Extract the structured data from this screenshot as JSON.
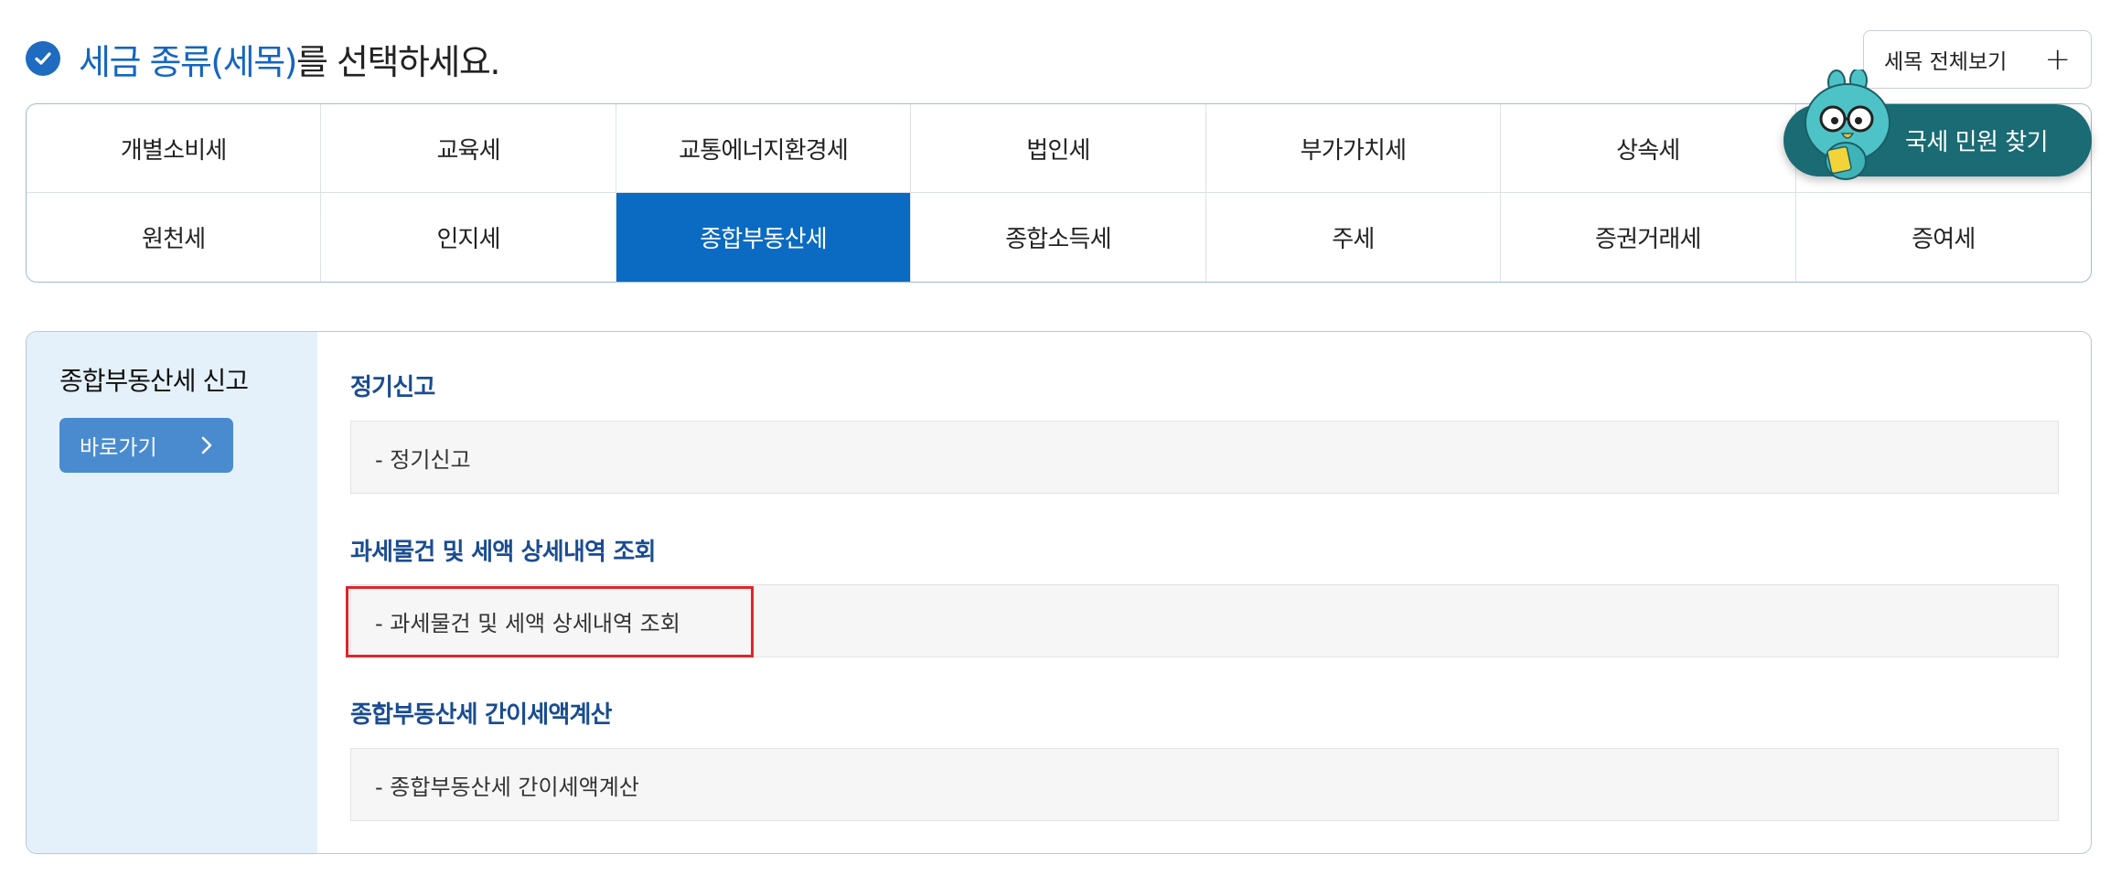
{
  "heading": {
    "highlight": "세금 종류(세목)",
    "rest": "를 선택하세요."
  },
  "view_all": {
    "label": "세목 전체보기",
    "icon": "+"
  },
  "tax_types": [
    "개별소비세",
    "교육세",
    "교통에너지환경세",
    "법인세",
    "부가가치세",
    "상속세",
    "",
    "원천세",
    "인지세",
    "종합부동산세",
    "종합소득세",
    "주세",
    "증권거래세",
    "증여세"
  ],
  "active_tax": "종합부동산세",
  "mascot": {
    "label": "국세 민원 찾기",
    "color": "#1a6b73"
  },
  "panel": {
    "side_title": "종합부동산세 신고",
    "shortcut_label": "바로가기",
    "sections": [
      {
        "title": "정기신고",
        "link": "- 정기신고"
      },
      {
        "title": "과세물건 및 세액 상세내역 조회",
        "link": "- 과세물건 및 세액 상세내역 조회"
      },
      {
        "title": "종합부동산세 간이세액계산",
        "link": "- 종합부동산세 간이세액계산"
      }
    ]
  },
  "colors": {
    "accent": "#0b6bc2",
    "section_title": "#1a4c91",
    "side_bg": "#e4f1fa",
    "highlight": "#e0252a"
  }
}
